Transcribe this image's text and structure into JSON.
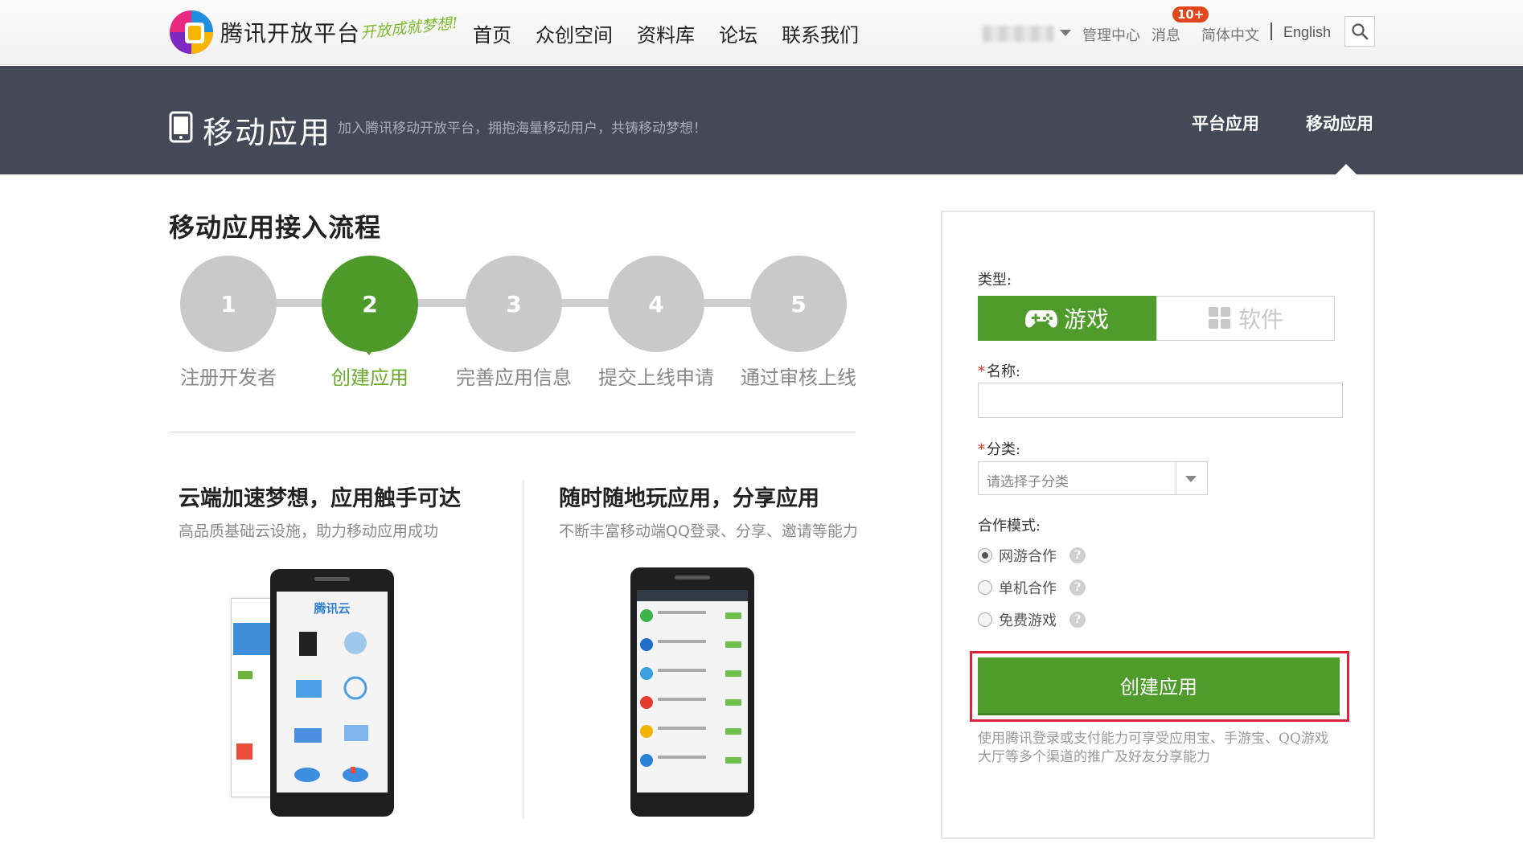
{
  "header": {
    "brand_name": "腾讯开放平台",
    "brand_slogan": "开放成就梦想!",
    "nav": [
      "首页",
      "众创空间",
      "资料库",
      "论坛",
      "联系我们"
    ],
    "manage_center": "管理中心",
    "messages": "消息",
    "message_badge": "10+",
    "lang_zh": "简体中文",
    "lang_en": "English"
  },
  "banner": {
    "title": "移动应用",
    "subtitle": "加入腾讯移动开放平台，拥抱海量移动用户，共铸移动梦想！",
    "tabs": [
      "平台应用",
      "移动应用"
    ]
  },
  "process": {
    "title": "移动应用接入流程",
    "steps": [
      {
        "num": "1",
        "label": "注册开发者"
      },
      {
        "num": "2",
        "label": "创建应用"
      },
      {
        "num": "3",
        "label": "完善应用信息"
      },
      {
        "num": "4",
        "label": "提交上线申请"
      },
      {
        "num": "5",
        "label": "通过审核上线"
      }
    ],
    "active_step": 2
  },
  "features": [
    {
      "title": "云端加速梦想，应用触手可达",
      "desc": "高品质基础云设施，助力移动应用成功",
      "screen_brand": "腾讯云"
    },
    {
      "title": "随时随地玩应用，分享应用",
      "desc": "不断丰富移动端QQ登录、分享、邀请等能力"
    }
  ],
  "form": {
    "type_label": "类型:",
    "type_options": [
      "游戏",
      "软件"
    ],
    "type_selected": "游戏",
    "name_label": "名称:",
    "name_value": "",
    "category_label": "分类:",
    "category_placeholder": "请选择子分类",
    "mode_label": "合作模式:",
    "modes": [
      "网游合作",
      "单机合作",
      "免费游戏"
    ],
    "mode_selected": "网游合作",
    "help_glyph": "?",
    "required_mark": "*",
    "create_button": "创建应用",
    "note": "使用腾讯登录或支付能力可享受应用宝、手游宝、QQ游戏大厅等多个渠道的推广及好友分享能力"
  },
  "colors": {
    "accent_green": "#4f9c2d",
    "banner_bg": "#434956",
    "highlight_red": "#e0213f",
    "badge_red": "#e0471d"
  }
}
